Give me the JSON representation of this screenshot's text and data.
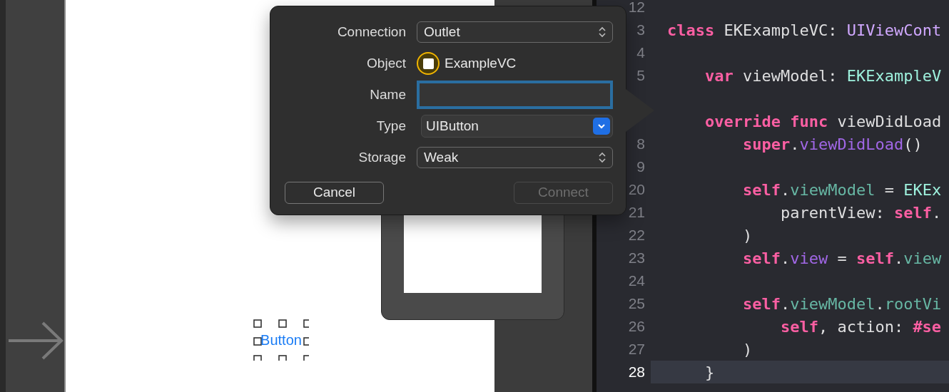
{
  "canvas": {
    "button_label": "Button",
    "button_selected": true
  },
  "popover": {
    "rows": [
      {
        "kind": "popup",
        "label": "Connection",
        "value": "Outlet"
      },
      {
        "kind": "object",
        "label": "Object",
        "value": "ExampleVC"
      },
      {
        "kind": "field",
        "label": "Name",
        "focused": true
      },
      {
        "kind": "combo",
        "label": "Type",
        "value": "UIButton"
      },
      {
        "kind": "popup",
        "label": "Storage",
        "value": "Weak"
      }
    ],
    "buttons": [
      {
        "label": "Cancel",
        "disabled": false
      },
      {
        "label": "Connect",
        "disabled": true
      }
    ]
  },
  "editor": {
    "lines": [
      {
        "number": "12",
        "current": false
      },
      {
        "number": "3",
        "current": false,
        "tokens": [
          {
            "kind": "keyword",
            "text": "class"
          },
          {
            "kind": "plain",
            "text": " EKExampleVC: "
          },
          {
            "kind": "type",
            "text": "UIViewCont"
          }
        ]
      },
      {
        "number": "4",
        "current": false
      },
      {
        "number": "5",
        "current": false,
        "tokens": [
          {
            "kind": "keyword",
            "text": "    var"
          },
          {
            "kind": "plain",
            "text": " viewModel: "
          },
          {
            "kind": "project_type",
            "text": "EKExampleV"
          }
        ]
      },
      {
        "current": false
      },
      {
        "current": false,
        "tokens": [
          {
            "kind": "keyword",
            "text": "    override"
          },
          {
            "kind": "keyword",
            "text": " func"
          },
          {
            "kind": "plain",
            "text": " viewDidLoad"
          }
        ]
      },
      {
        "number": "8",
        "current": false,
        "tokens": [
          {
            "kind": "keyword",
            "text": "        super"
          },
          {
            "kind": "plain",
            "text": "."
          },
          {
            "kind": "system_member",
            "text": "viewDidLoad"
          },
          {
            "kind": "plain",
            "text": "()"
          }
        ]
      },
      {
        "number": "9",
        "current": false
      },
      {
        "number": "20",
        "current": false,
        "tokens": [
          {
            "kind": "keyword",
            "text": "        self"
          },
          {
            "kind": "plain",
            "text": "."
          },
          {
            "kind": "project_member",
            "text": "viewModel"
          },
          {
            "kind": "plain",
            "text": " = "
          },
          {
            "kind": "project_type",
            "text": "EKEx"
          }
        ]
      },
      {
        "number": "21",
        "current": false,
        "tokens": [
          {
            "kind": "plain",
            "text": "            parentView: "
          },
          {
            "kind": "keyword",
            "text": "self"
          },
          {
            "kind": "plain",
            "text": "."
          }
        ]
      },
      {
        "number": "22",
        "current": false,
        "tokens": [
          {
            "kind": "plain",
            "text": "        )"
          }
        ]
      },
      {
        "number": "23",
        "current": false,
        "tokens": [
          {
            "kind": "keyword",
            "text": "        self"
          },
          {
            "kind": "plain",
            "text": "."
          },
          {
            "kind": "system_member",
            "text": "view"
          },
          {
            "kind": "plain",
            "text": " = "
          },
          {
            "kind": "keyword",
            "text": "self"
          },
          {
            "kind": "plain",
            "text": "."
          },
          {
            "kind": "project_member",
            "text": "view"
          }
        ]
      },
      {
        "number": "24",
        "current": false
      },
      {
        "number": "25",
        "current": false,
        "tokens": [
          {
            "kind": "keyword",
            "text": "        self"
          },
          {
            "kind": "plain",
            "text": "."
          },
          {
            "kind": "project_member",
            "text": "viewModel"
          },
          {
            "kind": "plain",
            "text": "."
          },
          {
            "kind": "project_member",
            "text": "rootVi"
          }
        ]
      },
      {
        "number": "26",
        "current": false,
        "tokens": [
          {
            "kind": "keyword",
            "text": "            self"
          },
          {
            "kind": "plain",
            "text": ", action: "
          },
          {
            "kind": "keyword",
            "text": "#se"
          }
        ]
      },
      {
        "number": "27",
        "current": false,
        "tokens": [
          {
            "kind": "plain",
            "text": "        )"
          }
        ]
      },
      {
        "number": "28",
        "current": true,
        "tokens": [
          {
            "kind": "plain",
            "text": "    }"
          }
        ]
      }
    ]
  }
}
